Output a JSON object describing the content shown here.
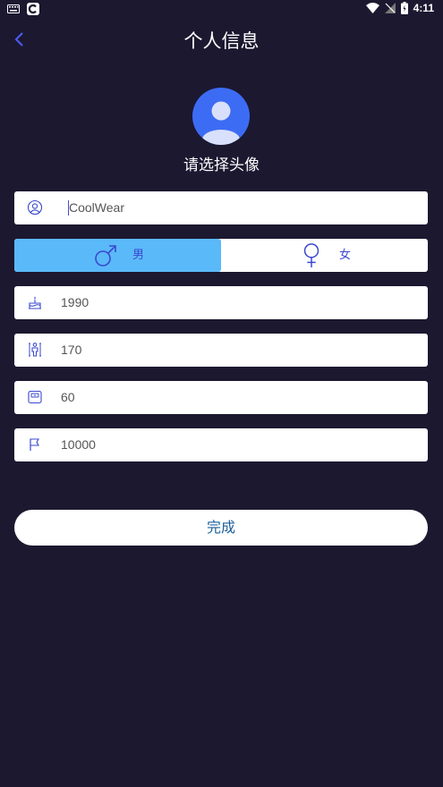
{
  "status": {
    "time": "4:11"
  },
  "header": {
    "title": "个人信息"
  },
  "avatar": {
    "label": "请选择头像"
  },
  "form": {
    "name": "CoolWear",
    "gender": {
      "male": "男",
      "female": "女",
      "selected": "male"
    },
    "birth_year": "1990",
    "height": "170",
    "weight": "60",
    "step_goal": "10000"
  },
  "done_label": "完成",
  "colors": {
    "background": "#1c1830",
    "accent": "#3d6cf4",
    "selected": "#5ab9f9",
    "icon": "#3a48d0"
  }
}
